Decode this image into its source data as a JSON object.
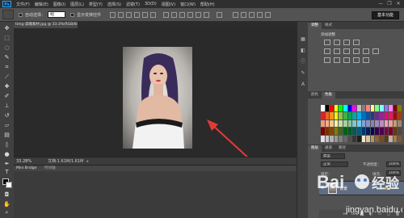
{
  "app": {
    "logo": "Ps",
    "menu": [
      "文件(F)",
      "编辑(E)",
      "图像(I)",
      "图层(L)",
      "类型(Y)",
      "选择(S)",
      "滤镜(T)",
      "3D(D)",
      "视图(V)",
      "窗口(W)",
      "帮助(H)"
    ],
    "window_buttons": [
      "—",
      "❐",
      "✕"
    ]
  },
  "options": {
    "auto_select_label": "自动选择：",
    "auto_select_value": "组",
    "show_transform_label": "显示变换控件",
    "workspace": "基本功能"
  },
  "document": {
    "tab_title": "timg-美瞳素材.jpg @ 33.3%(RGB/8#)",
    "zoom": "33.28%",
    "doc_size": "文档:1.61M/1.61M",
    "mini_bridge_tab": "Mini Bridge",
    "timeline_tab": "时间轴"
  },
  "panels": {
    "adjust_tabs": [
      "调整",
      "样式"
    ],
    "adjust_title": "添加调整",
    "swatch_tabs": [
      "颜色",
      "色板"
    ],
    "layers_tabs": [
      "图层",
      "通道",
      "路径"
    ],
    "blend_mode": "正常",
    "opacity_label": "不透明度：",
    "opacity_value": "100%",
    "fill_label": "填充：",
    "fill_value": "100%",
    "lock_label": "锁定：",
    "kind_label": "类型",
    "layer_name": "背景"
  },
  "watermark": {
    "brand": "Bai",
    "brand_cn": "经验",
    "url": "jingyan.baidu.com"
  },
  "colors": {
    "accent": "#31a8ff",
    "arrow": "#e53935",
    "layer_selected": "#606d83",
    "canvas_bg": "#2a2a2a"
  },
  "swatches": [
    "#ffffff",
    "#000000",
    "#ff0000",
    "#ffff00",
    "#00ff00",
    "#00ffff",
    "#0000ff",
    "#ff00ff",
    "#c0c0c0",
    "#808080",
    "#ff8080",
    "#ffff80",
    "#80ff80",
    "#80ffff",
    "#8080ff",
    "#ff80ff",
    "#800000",
    "#808000",
    "#ed1c24",
    "#f26522",
    "#f7941d",
    "#fff200",
    "#8dc63f",
    "#39b54a",
    "#00a651",
    "#00a99d",
    "#00aeef",
    "#0072bc",
    "#0054a6",
    "#2e3192",
    "#662d91",
    "#92278f",
    "#ec008c",
    "#ed145b",
    "#9e0b0f",
    "#a0410d",
    "#f69679",
    "#f9ad81",
    "#fdc68a",
    "#fff799",
    "#c4df9b",
    "#a3d39c",
    "#82ca9c",
    "#7accc8",
    "#6dcff6",
    "#7da7d9",
    "#8393ca",
    "#8781bd",
    "#a187be",
    "#bd8cbf",
    "#f49ac1",
    "#f5989d",
    "#c69c6d",
    "#998675",
    "#790000",
    "#7b2e00",
    "#7d4900",
    "#827b00",
    "#406618",
    "#005e20",
    "#005826",
    "#005952",
    "#005b7f",
    "#003663",
    "#002157",
    "#0d004c",
    "#32004b",
    "#4b0049",
    "#7b0046",
    "#7a0026",
    "#603913",
    "#534741",
    "#e0e0e0",
    "#c8c8c8",
    "#b0b0b0",
    "#989898",
    "#7e7e7e",
    "#666666",
    "#4e4e4e",
    "#363636",
    "#1e1e1e",
    "#f2e6cc",
    "#d9c49c",
    "#b8945b",
    "#8c6239",
    "#754c24",
    "#603913",
    "#c7b299",
    "#a67c52",
    "#7e5a35"
  ]
}
